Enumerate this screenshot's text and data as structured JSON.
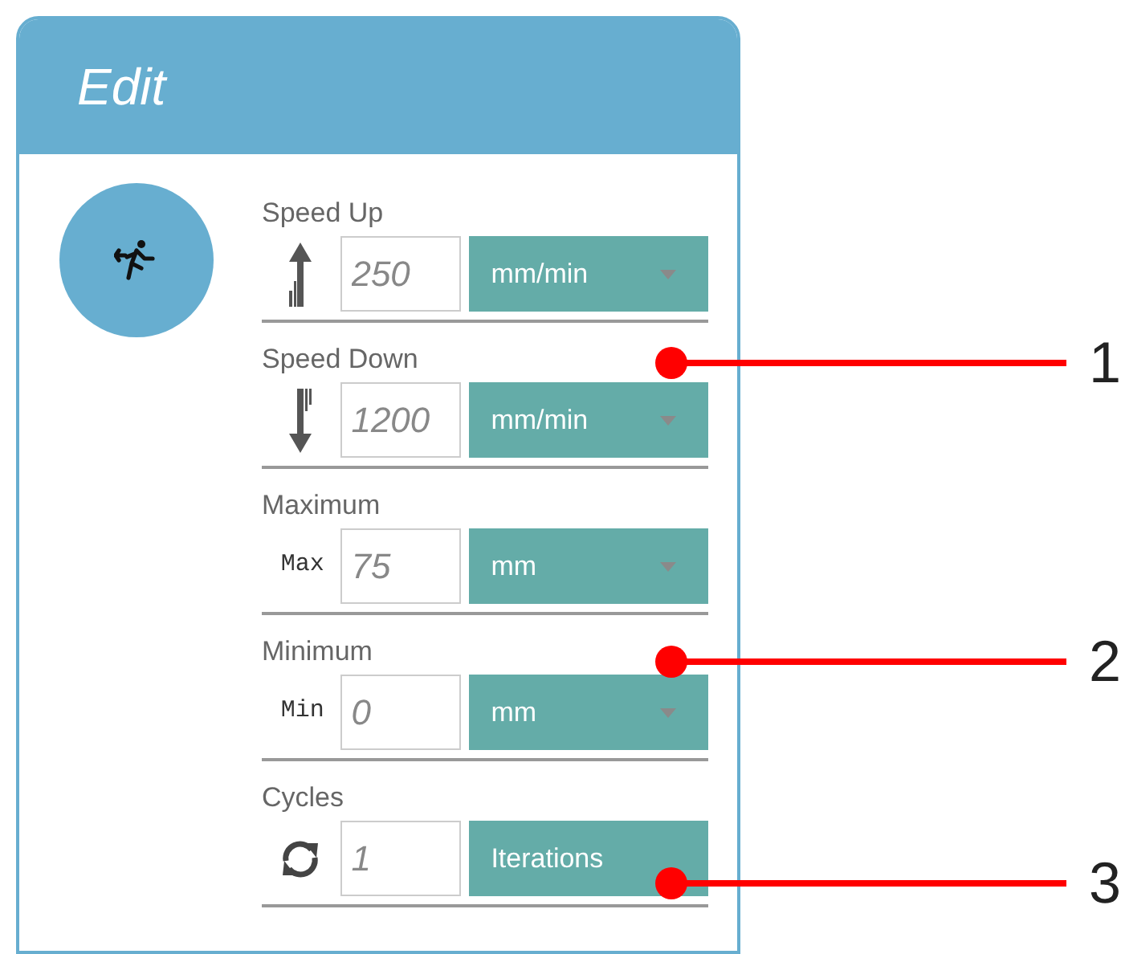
{
  "panel": {
    "title": "Edit"
  },
  "rows": [
    {
      "label": "Speed Up",
      "kind": "arrow-up",
      "value": "250",
      "unit": "mm/min",
      "dropdown": true
    },
    {
      "label": "Speed Down",
      "kind": "arrow-down",
      "value": "1200",
      "unit": "mm/min",
      "dropdown": true
    },
    {
      "label": "Maximum",
      "kind": "text",
      "prefix": "Max",
      "value": "75",
      "unit": "mm",
      "dropdown": true
    },
    {
      "label": "Minimum",
      "kind": "text",
      "prefix": "Min",
      "value": "0",
      "unit": "mm",
      "dropdown": true
    },
    {
      "label": "Cycles",
      "kind": "cycle",
      "value": "1",
      "unit": "Iterations",
      "dropdown": false
    }
  ],
  "callouts": [
    {
      "number": "1"
    },
    {
      "number": "2"
    },
    {
      "number": "3"
    }
  ]
}
